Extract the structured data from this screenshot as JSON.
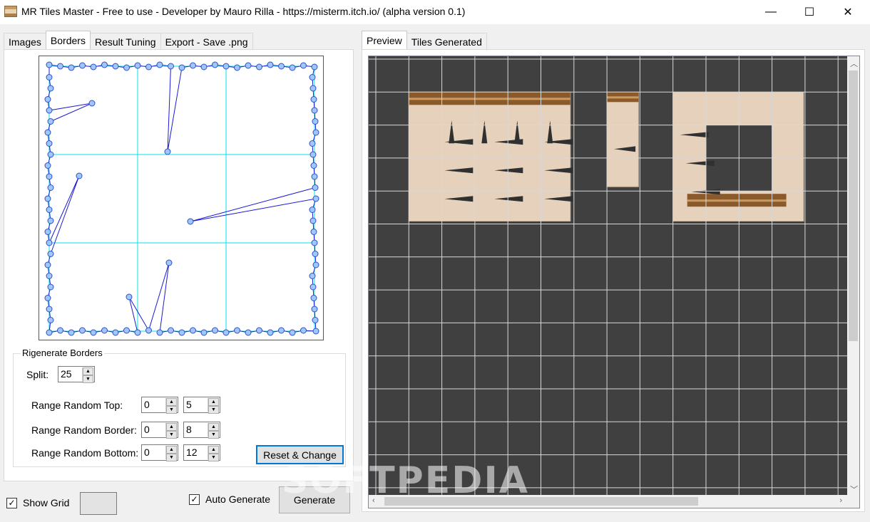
{
  "window": {
    "title": "MR Tiles Master - Free to use  - Developer by Mauro Rilla -  https://misterm.itch.io/ (alpha version 0.1)",
    "minimize": "—",
    "maximize": "☐",
    "close": "✕"
  },
  "left_tabs": [
    {
      "label": "Images"
    },
    {
      "label": "Borders"
    },
    {
      "label": "Result Tuning"
    },
    {
      "label": "Export - Save .png"
    }
  ],
  "right_tabs": [
    {
      "label": "Preview"
    },
    {
      "label": "Tiles Generated"
    }
  ],
  "rigenerate": {
    "legend": "Rigenerate Borders",
    "split_label": "Split:",
    "split_value": "25",
    "top_label": "Range Random Top:",
    "top_min": "0",
    "top_max": "5",
    "border_label": "Range Random Border:",
    "border_min": "0",
    "border_max": "8",
    "bottom_label": "Range Random Bottom:",
    "bottom_min": "0",
    "bottom_max": "12",
    "reset_button": "Reset & Change"
  },
  "bottom_bar": {
    "show_grid_label": "Show Grid",
    "show_grid_checked": "✓",
    "auto_generate_label": "Auto Generate",
    "auto_generate_checked": "✓",
    "generate_button": "Generate"
  },
  "watermark": "SOFTPEDIA",
  "colors": {
    "grid_line": "#00e5ee",
    "border_line": "#1a1ad6",
    "node_fill": "#9ec7ff",
    "preview_bg": "#404040",
    "preview_grid": "#d8d8d8"
  }
}
